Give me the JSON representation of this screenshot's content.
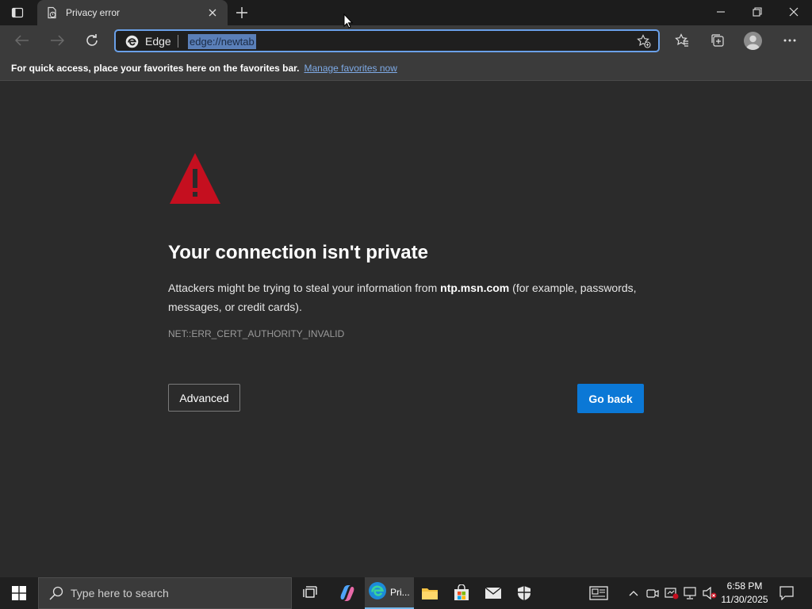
{
  "browser": {
    "tab_title": "Privacy error",
    "site_label": "Edge",
    "url": "edge://newtab"
  },
  "favorites_bar": {
    "message": "For quick access, place your favorites here on the favorites bar.",
    "link": "Manage favorites now"
  },
  "error_page": {
    "heading": "Your connection isn't private",
    "desc_before": "Attackers might be trying to steal your information from ",
    "host": "ntp.msn.com",
    "desc_after": " (for example, passwords, messages, or credit cards).",
    "error_code": "NET::ERR_CERT_AUTHORITY_INVALID",
    "advanced_label": "Advanced",
    "go_back_label": "Go back"
  },
  "taskbar": {
    "search_placeholder": "Type here to search",
    "edge_label": "Pri...",
    "time": "6:58 PM",
    "date": "11/30/2025"
  },
  "colors": {
    "accent": "#0b78d6",
    "warning": "#c50f1f",
    "link": "#7eaae6"
  }
}
